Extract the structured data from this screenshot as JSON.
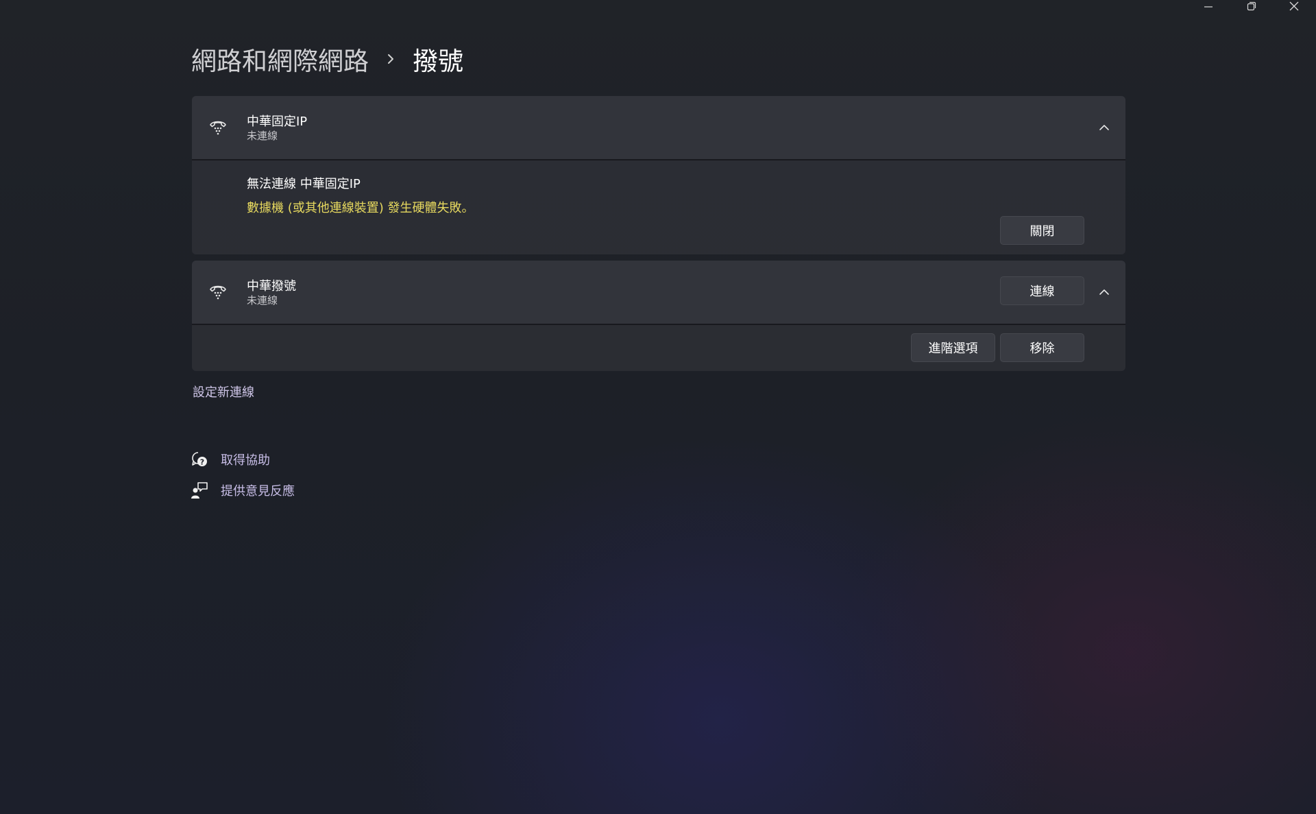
{
  "window": {
    "minimize_icon": "minimize-icon",
    "restore_icon": "restore-icon",
    "close_icon": "close-icon"
  },
  "breadcrumb": {
    "parent": "網路和網際網路",
    "separator_icon": "chevron-right-icon",
    "current": "撥號"
  },
  "connections": [
    {
      "icon": "dialup-phone-icon",
      "name": "中華固定IP",
      "status": "未連線",
      "expanded": true,
      "error": {
        "title": "無法連線 中華固定IP",
        "message": "數據機 (或其他連線裝置) 發生硬體失敗。",
        "close_label": "關閉"
      }
    },
    {
      "icon": "dialup-phone-icon",
      "name": "中華撥號",
      "status": "未連線",
      "expanded": true,
      "connect_label": "連線",
      "advanced_label": "進階選項",
      "remove_label": "移除"
    }
  ],
  "new_connection_label": "設定新連線",
  "help_links": [
    {
      "icon": "get-help-icon",
      "label": "取得協助"
    },
    {
      "icon": "feedback-icon",
      "label": "提供意見反應"
    }
  ],
  "colors": {
    "error_text": "#e7d95f",
    "link_text": "#c7bde6"
  }
}
